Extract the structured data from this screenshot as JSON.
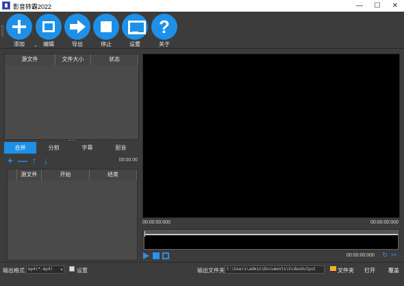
{
  "window": {
    "title": "影音转霸2022",
    "controls": [
      "—",
      "☐",
      "✕"
    ]
  },
  "toolbar": {
    "buttons": [
      {
        "label": "添加",
        "icon": "plus-icon"
      },
      {
        "label": "编辑",
        "icon": "film-icon"
      },
      {
        "label": "导出",
        "icon": "arrow-right-icon"
      },
      {
        "label": "停止",
        "icon": "stop-icon"
      },
      {
        "label": "设置",
        "icon": "monitor-icon"
      },
      {
        "label": "关于",
        "icon": "question-icon"
      }
    ],
    "dropdown_glyph": "⌄"
  },
  "file_list": {
    "columns": [
      "源文件",
      "文件大小",
      "状态"
    ]
  },
  "tabs": [
    "合并",
    "分割",
    "字幕",
    "配音"
  ],
  "active_tab": "合并",
  "segment_tools": {
    "glyphs": [
      "+",
      "—",
      "↑",
      "↓"
    ],
    "time": "00:00:00"
  },
  "segment_list": {
    "columns": [
      "源文件",
      "开始",
      "结束"
    ]
  },
  "preview": {
    "time_left": "00:00:00:000",
    "time_right": "00:00:00:000",
    "time_bottom": "00:00:00:000",
    "scissors_glyph": "✂",
    "loop_glyph": "↻"
  },
  "status": {
    "format_label": "输出格式",
    "format_value": "mp4(*.mp4)",
    "format_arrow": "▾",
    "settings_label": "设置",
    "folder_label": "输出文件夹",
    "folder_path": "C:\\Users\\admin\\Documents\\VideoOutput",
    "browse_label": "文件夹",
    "open_label": "打开",
    "overwrite_label": "覆盖"
  }
}
